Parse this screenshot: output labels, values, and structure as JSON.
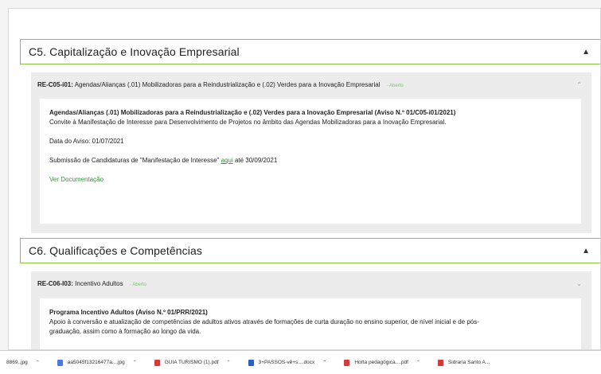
{
  "sections": [
    {
      "title": "C5. Capitalização e Inovação Empresarial",
      "subsection": {
        "code": "RE-C05-i01:",
        "label": "Agendas/Alianças (.01) Mobilizadoras para a Reindustrialização e (.02) Verdes para a Inovação Empresarial",
        "status": "- Aberto",
        "content": {
          "heading": "Agendas/Alianças (.01) Mobilizadoras para a Reindustrialização e (.02) Verdes para a Inovação Empresarial (Aviso N.º 01/C05-i01/2021)",
          "description": "Convite à Manifestação de Interesse para Desenvolvimento de Projetos no âmbito das Agendas Mobilizadoras para a Inovação Empresarial.",
          "notice_date": "Data do Aviso: 01/07/2021",
          "submission_prefix": "Submissão de Candidaturas de \"Manifestação de Interesse\" ",
          "submission_link": "aqui",
          "submission_suffix": " até 30/09/2021",
          "documentation_link": "Ver Documentação"
        }
      }
    },
    {
      "title": "C6. Qualificações e Competências",
      "subsection": {
        "code": "RE-C06-I03:",
        "label": "Incentivo Adultos",
        "status": "- Aberto",
        "content": {
          "heading": "Programa Incentivo Adultos (Aviso N.º 01/PRR/2021)",
          "description_line1": "Apoio à conversão e atualização de competências de adultos ativos através de formações de curta duração no ensino superior, de nível inicial e de pós-",
          "description_line2": "graduação, assim como à formação ao longo da vida."
        }
      }
    }
  ],
  "downloads": [
    {
      "name": "8869..jpg",
      "color": "#4a7bd8"
    },
    {
      "name": "aa5045f13216477a....jpg",
      "color": "#4a7bd8"
    },
    {
      "name": "GUIA TURISMO (1).pdf",
      "color": "#d33b3b"
    },
    {
      "name": "3+PASSOS-vê+s....docx",
      "color": "#2b5fb8"
    },
    {
      "name": "Horta pedagógica....pdf",
      "color": "#d33b3b"
    },
    {
      "name": "Sidraria Santo A...",
      "color": "#d33b3b"
    }
  ]
}
